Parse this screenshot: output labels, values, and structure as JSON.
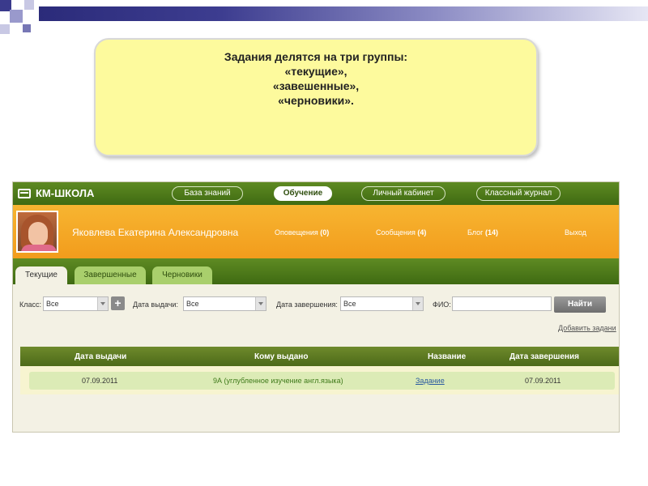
{
  "callout": {
    "line1": "Задания делятся на три группы:",
    "line2": "«текущие»,",
    "line3": "«завешенные»,",
    "line4": "«черновики»."
  },
  "app": {
    "logo": "КМ-ШКОЛА",
    "nav": [
      "База знаний",
      "Обучение",
      "Личный кабинет",
      "Классный журнал"
    ],
    "user": {
      "name": "Яковлева Екатерина Александровна",
      "notifications_label": "Оповещения",
      "notifications_count": "(0)",
      "messages_label": "Сообщения",
      "messages_count": "(4)",
      "blog_label": "Блог",
      "blog_count": "(14)",
      "logout": "Выход"
    },
    "tabs": [
      "Текущие",
      "Завершенные",
      "Черновики"
    ],
    "filters": {
      "class_label": "Класс:",
      "class_value": "Все",
      "issue_date_label": "Дата выдачи:",
      "issue_date_value": "Все",
      "end_date_label": "Дата завершения:",
      "end_date_value": "Все",
      "fio_label": "ФИО:",
      "fio_value": "",
      "find_button": "Найти"
    },
    "add_task_link": "Добавить задани",
    "table": {
      "headers": [
        "Дата выдачи",
        "Кому выдано",
        "Название",
        "Дата завершения"
      ],
      "rows": [
        [
          "07.09.2011",
          "9А (углубленное изучение англ.языка)",
          "Задание",
          "07.09.2011"
        ]
      ]
    }
  },
  "colors": {
    "header_green": "#4d7a18",
    "user_orange": "#f4a826",
    "callout_yellow": "#fdfa9d"
  }
}
